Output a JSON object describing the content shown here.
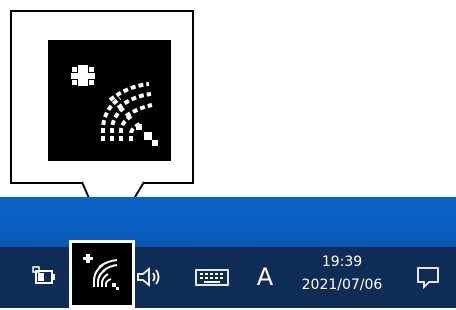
{
  "clock": {
    "time": "19:39",
    "date": "2021/07/06"
  },
  "ime": {
    "label": "A"
  },
  "icons": {
    "callout": "wifi-airplane-icon",
    "battery": "battery-icon",
    "wifi": "wifi-airplane-icon",
    "volume": "volume-icon",
    "keyboard": "keyboard-icon",
    "notifications": "notification-icon"
  },
  "colors": {
    "desktop": "#0b63c6",
    "taskbar": "#0e2c55",
    "highlight_border": "#ffffff"
  }
}
